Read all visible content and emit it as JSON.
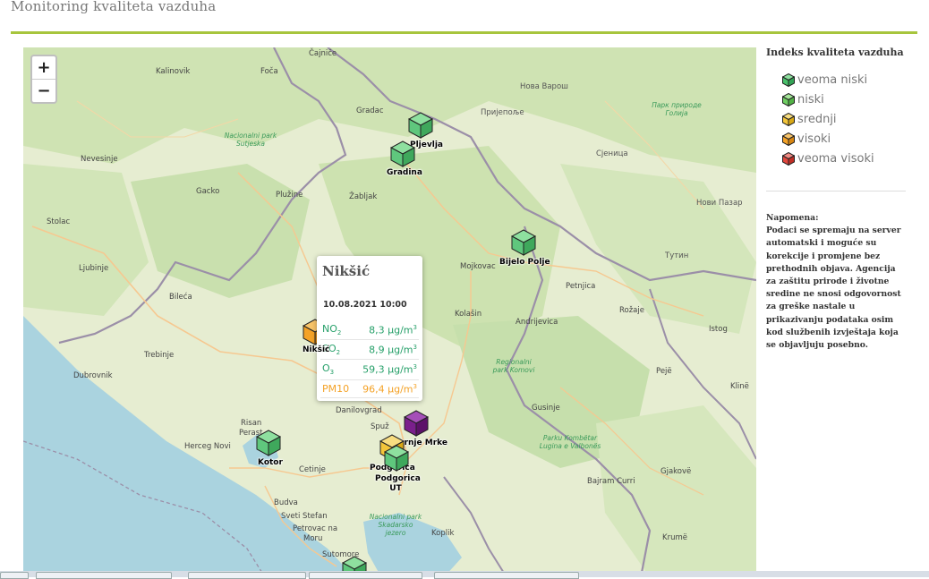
{
  "page": {
    "title": "Monitoring kvaliteta vazduha"
  },
  "map": {
    "zoom_in": "+",
    "zoom_out": "−",
    "places": [
      {
        "id": "cajnice",
        "label": "Čajniče"
      },
      {
        "id": "kalinovik",
        "label": "Kalinovik"
      },
      {
        "id": "foca",
        "label": "Foča"
      },
      {
        "id": "nova-varos",
        "label": "Нова Варош"
      },
      {
        "id": "gradac",
        "label": "Gradac"
      },
      {
        "id": "prijepolje",
        "label": "Пријепоље"
      },
      {
        "id": "nevesinje",
        "label": "Nevesinje"
      },
      {
        "id": "sjenica",
        "label": "Сјеница"
      },
      {
        "id": "gacko",
        "label": "Gacko"
      },
      {
        "id": "pluzine",
        "label": "Plužine"
      },
      {
        "id": "zabljak",
        "label": "Žabljak"
      },
      {
        "id": "novi-pazar",
        "label": "Нови Пазар"
      },
      {
        "id": "stolac",
        "label": "Stolac"
      },
      {
        "id": "ljubinje",
        "label": "Ljubinje"
      },
      {
        "id": "tutin",
        "label": "Тутин"
      },
      {
        "id": "mojkovac",
        "label": "Mojkovac"
      },
      {
        "id": "petnjica",
        "label": "Petnjica"
      },
      {
        "id": "bileca",
        "label": "Bileća"
      },
      {
        "id": "kolasin",
        "label": "Kolašin"
      },
      {
        "id": "rozaje",
        "label": "Rožaje"
      },
      {
        "id": "andrijevica",
        "label": "Andrijevica"
      },
      {
        "id": "istog",
        "label": "Istog"
      },
      {
        "id": "trebinje",
        "label": "Trebinje"
      },
      {
        "id": "dubrovnik",
        "label": "Dubrovnik"
      },
      {
        "id": "peje",
        "label": "Pejë"
      },
      {
        "id": "kline",
        "label": "Klinë"
      },
      {
        "id": "danilovgrad",
        "label": "Danilovgrad"
      },
      {
        "id": "spuz",
        "label": "Spuž"
      },
      {
        "id": "gusinje",
        "label": "Gusinje"
      },
      {
        "id": "risan",
        "label": "Risan"
      },
      {
        "id": "perast",
        "label": "Perast"
      },
      {
        "id": "herceg-novi",
        "label": "Herceg Novi"
      },
      {
        "id": "cetinje",
        "label": "Cetinje"
      },
      {
        "id": "gjakove",
        "label": "Gjakovë"
      },
      {
        "id": "bajram-curri",
        "label": "Bajram Curri"
      },
      {
        "id": "budva",
        "label": "Budva"
      },
      {
        "id": "sveti-stefan",
        "label": "Sveti Stefan"
      },
      {
        "id": "petrovac",
        "label": "Petrovac na"
      },
      {
        "id": "moru",
        "label": "Moru"
      },
      {
        "id": "koplik",
        "label": "Koplik"
      },
      {
        "id": "sutomore",
        "label": "Sutomore"
      },
      {
        "id": "krume",
        "label": "Krumë"
      }
    ],
    "parks": [
      {
        "id": "sutjeska",
        "label": "Nacionalni park Sutjeska"
      },
      {
        "id": "golija",
        "label": "Парк природе Голија"
      },
      {
        "id": "komovi",
        "label": "Regionalni park Komovi"
      },
      {
        "id": "valbone",
        "label": "Parku Kombëtar Lugina e Valbonës"
      },
      {
        "id": "skadarsko",
        "label": "Nacionalni park Skadarsko jezero"
      }
    ],
    "stations": [
      {
        "id": "pljevlja",
        "label": "Pljevlja",
        "color": "#5fc77d"
      },
      {
        "id": "gradina",
        "label": "Gradina",
        "color": "#5fc77d"
      },
      {
        "id": "bijelo-polje",
        "label": "Bijelo Polje",
        "color": "#5fc77d"
      },
      {
        "id": "niksic",
        "label": "Nikšić",
        "color": "#f4a227"
      },
      {
        "id": "kotor",
        "label": "Kotor",
        "color": "#5fc77d"
      },
      {
        "id": "gornje-mrke",
        "label": "Gornje Mrke",
        "color": "#7a1f8c"
      },
      {
        "id": "podgorica",
        "label": "Podgorica",
        "color": "#f3c53a"
      },
      {
        "id": "podgorica-ut",
        "label": "Podgorica UT",
        "color": "#5fc77d"
      },
      {
        "id": "bar",
        "label": "",
        "color": "#5fc77d"
      }
    ],
    "popup": {
      "title": "Nikšić",
      "datetime": "10.08.2021 10:00",
      "rows": [
        {
          "name": "NO",
          "sub": "2",
          "value": "8,3 µg/m",
          "sup": "3",
          "level": "g"
        },
        {
          "name": "SO",
          "sub": "2",
          "value": "8,9 µg/m",
          "sup": "3",
          "level": "g"
        },
        {
          "name": "O",
          "sub": "3",
          "value": "59,3 µg/m",
          "sup": "3",
          "level": "g"
        },
        {
          "name": "PM10",
          "sub": "",
          "value": "96,4 µg/m",
          "sup": "3",
          "level": "o"
        }
      ]
    }
  },
  "legend": {
    "title": "Indeks kvaliteta vazduha",
    "items": [
      {
        "label": "veoma niski",
        "color": "#49c16b"
      },
      {
        "label": "niski",
        "color": "#6fcf62"
      },
      {
        "label": "srednji",
        "color": "#f3c53a"
      },
      {
        "label": "visoki",
        "color": "#f4a227"
      },
      {
        "label": "veoma visoki",
        "color": "#e2473e"
      }
    ],
    "note_title": "Napomena:",
    "note_text": "Podaci se spremaju na server automatski i moguće su korekcije i promjene bez prethodnih objava. Agencija za zaštitu prirode i životne sredine ne snosi odgovornost za greške nastale u prikazivanju podataka osim kod službenih izvještaja koja se objavljuju posebno."
  }
}
